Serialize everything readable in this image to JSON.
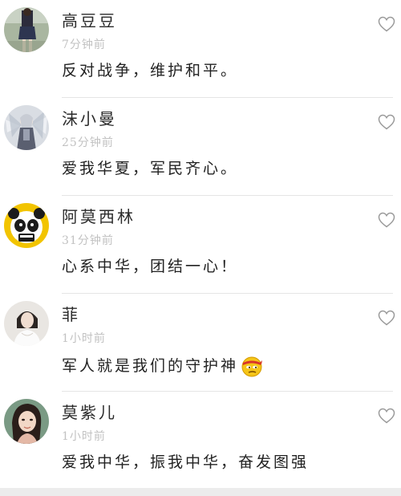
{
  "comments": [
    {
      "name": "高豆豆",
      "time": "7分钟前",
      "text": "反对战争，维护和平。",
      "avatar_icon": "avatar-girl-dark-dress"
    },
    {
      "name": "沫小曼",
      "time": "25分钟前",
      "text": "爱我华夏，军民齐心。",
      "avatar_icon": "avatar-anime-angel"
    },
    {
      "name": "阿莫西林",
      "time": "31分钟前",
      "text": "心系中华，团结一心！",
      "avatar_icon": "avatar-panda-cartoon"
    },
    {
      "name": "菲",
      "time": "1小时前",
      "text": "军人就是我们的守护神",
      "avatar_icon": "avatar-girl-white",
      "emoji_icon": "smirk-headband-emoji"
    },
    {
      "name": "莫紫儿",
      "time": "1小时前",
      "text": "爱我中华，振我中华，奋发图强",
      "avatar_icon": "avatar-girl-portrait"
    }
  ],
  "colors": {
    "name": "#2a2a2a",
    "time": "#c2c2c2",
    "text": "#222222",
    "divider": "#e5e5e5",
    "like_icon": "#9a9a9a"
  }
}
